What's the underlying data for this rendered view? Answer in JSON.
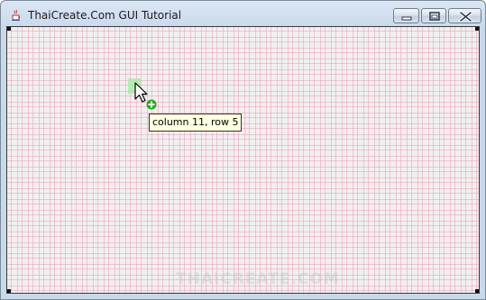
{
  "window": {
    "title": "ThaiCreate.Com GUI Tutorial",
    "icon": "java-coffee-cup-icon",
    "controls": [
      "minimize-icon",
      "maximize-icon",
      "close-icon"
    ]
  },
  "canvas": {
    "grid_color": "#eba0b4",
    "highlight_color": "#aaebaa"
  },
  "tooltip": {
    "text": "column 11, row 5"
  },
  "cursor": {
    "icon": "arrow-cursor-icon",
    "badge_icon": "add-plus-icon",
    "badge_color": "#22aa22"
  },
  "watermark": {
    "text": "THAICREATE.COM"
  }
}
